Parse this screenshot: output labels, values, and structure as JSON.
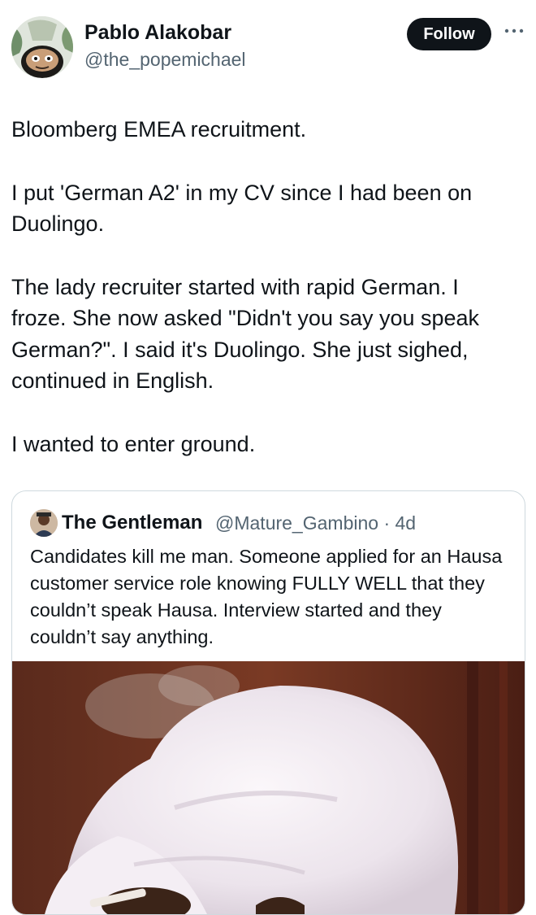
{
  "tweet": {
    "author": {
      "name": "Pablo Alakobar",
      "handle": "@the_popemichael"
    },
    "follow_label": "Follow",
    "paragraphs": [
      "Bloomberg EMEA recruitment.",
      "I put 'German A2' in my CV since I had been on Duolingo.",
      "The lady recruiter started with rapid German. I froze. She now asked \"Didn't you say you speak German?\". I said it's Duolingo. She just sighed, continued in English.",
      "I wanted to enter ground."
    ]
  },
  "quoted_tweet": {
    "author_name": "The Gentleman",
    "handle": "@Mature_Gambino",
    "separator": "·",
    "time": "4d",
    "text": "Candidates kill me man. Someone applied for an Hausa customer service role knowing FULLY WELL that they couldn’t speak Hausa. Interview started and they couldn’t say anything."
  },
  "icons": {
    "more": "more-horizontal-icon",
    "avatar": "avatar-image",
    "quoted_avatar": "avatar-image",
    "media": "media-photo"
  },
  "colors": {
    "follow_button": "#0f1419",
    "secondary_text": "#536471",
    "border": "#cfd9de"
  }
}
